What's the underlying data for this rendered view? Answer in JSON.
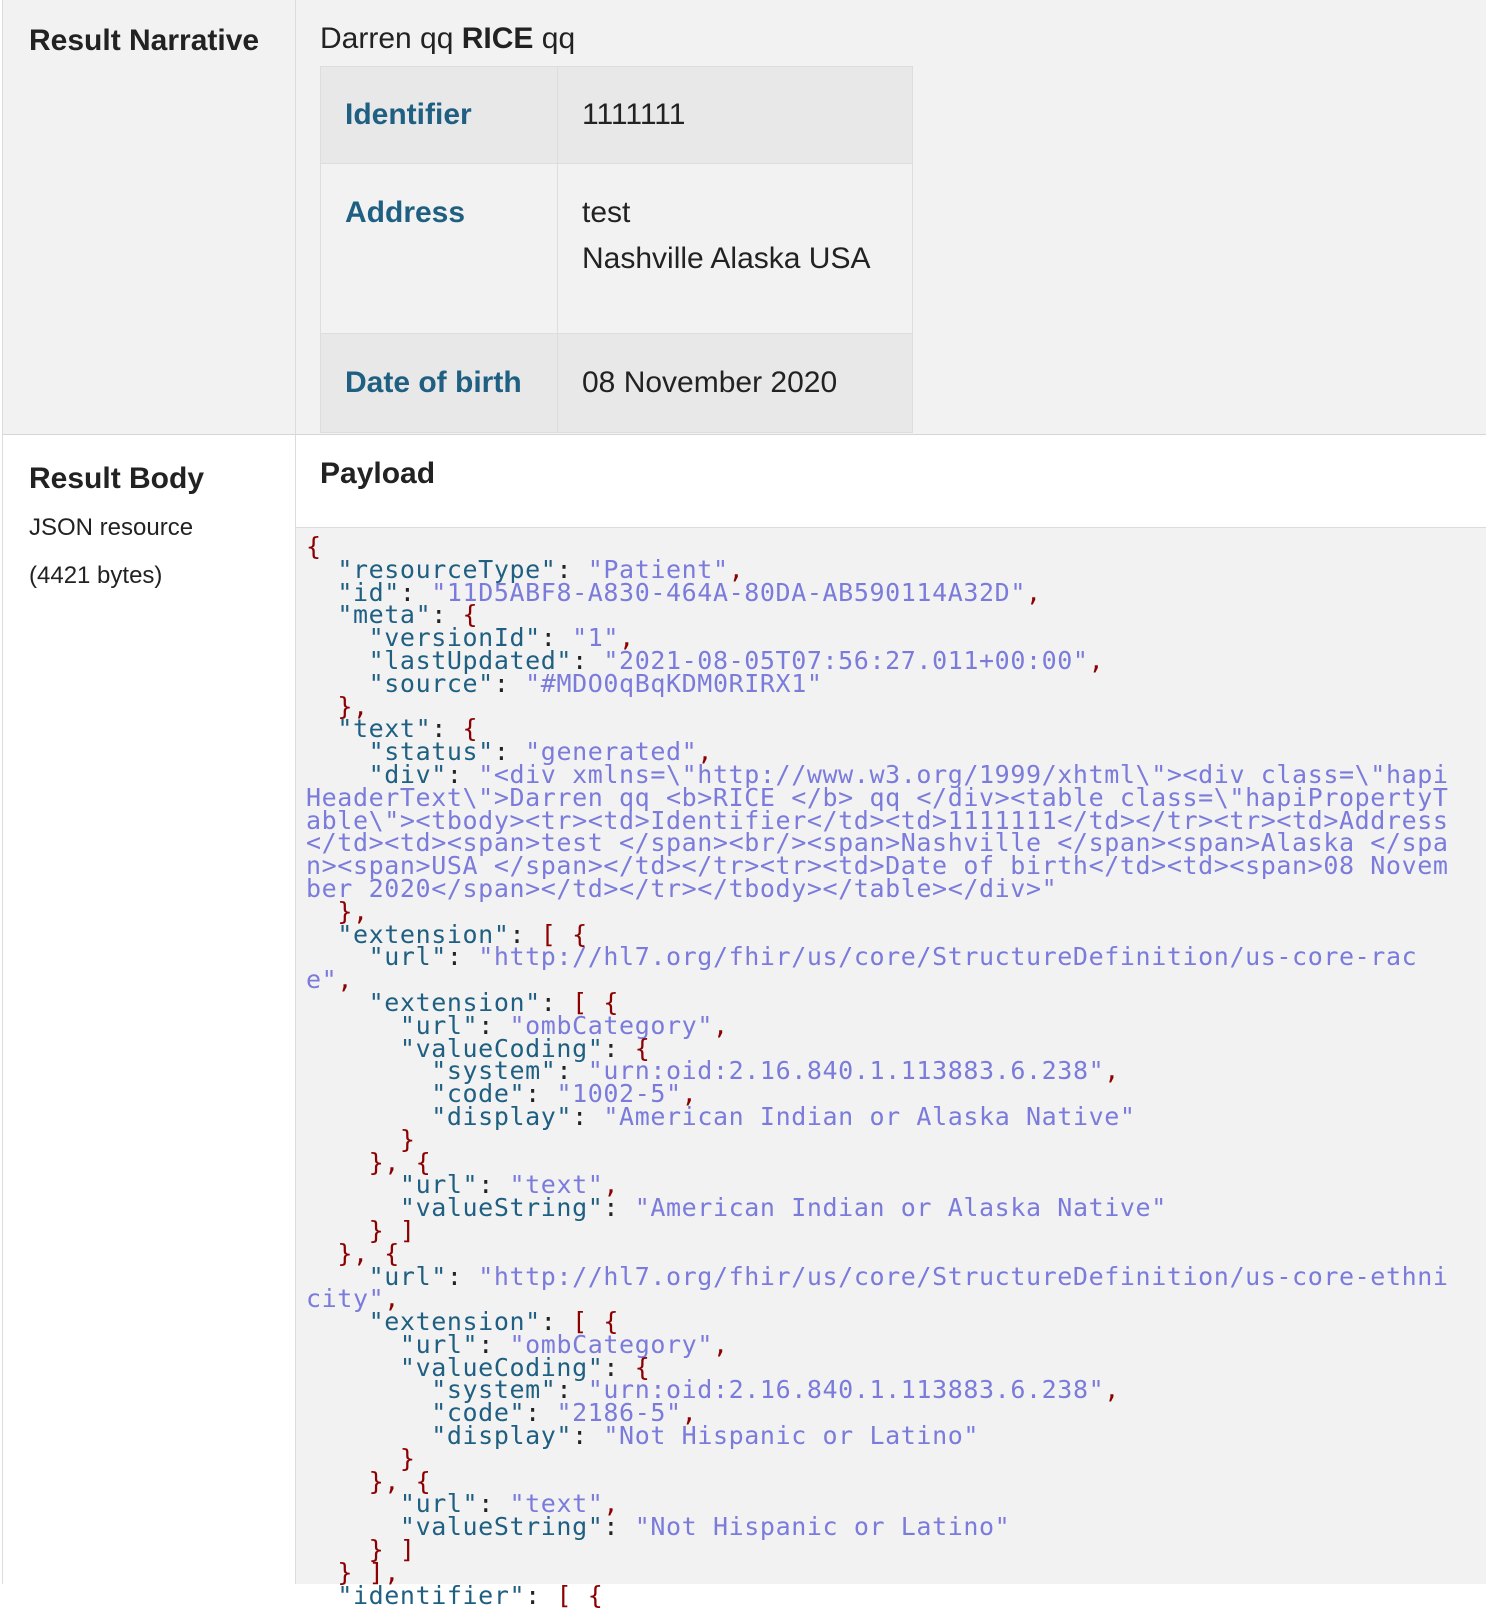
{
  "narrative": {
    "row_label": "Result Narrative",
    "header_name_given": "Darren qq ",
    "header_name_family": "RICE",
    "header_name_suffix": " qq",
    "rows": [
      {
        "label": "Identifier",
        "value_lines": [
          "1111111"
        ]
      },
      {
        "label": "Address",
        "value_lines": [
          "test",
          "Nashville Alaska USA"
        ]
      },
      {
        "label": "Date of birth",
        "value_lines": [
          "08 November 2020"
        ]
      }
    ]
  },
  "body": {
    "row_label": "Result Body",
    "format": "JSON resource",
    "size": "(4421 bytes)",
    "payload_title": "Payload",
    "json_text": "{\n  \"resourceType\": \"Patient\",\n  \"id\": \"11D5ABF8-A830-464A-80DA-AB590114A32D\",\n  \"meta\": {\n    \"versionId\": \"1\",\n    \"lastUpdated\": \"2021-08-05T07:56:27.011+00:00\",\n    \"source\": \"#MDO0qBqKDM0RIRX1\"\n  },\n  \"text\": {\n    \"status\": \"generated\",\n    \"div\": \"<div xmlns=\\\"http://www.w3.org/1999/xhtml\\\"><div class=\\\"hapiHeaderText\\\">Darren qq <b>RICE </b> qq </div><table class=\\\"hapiPropertyTable\\\"><tbody><tr><td>Identifier</td><td>1111111</td></tr><tr><td>Address</td><td><span>test </span><br/><span>Nashville </span><span>Alaska </span><span>USA </span></td></tr><tr><td>Date of birth</td><td><span>08 November 2020</span></td></tr></tbody></table></div>\"\n  },\n  \"extension\": [ {\n    \"url\": \"http://hl7.org/fhir/us/core/StructureDefinition/us-core-race\",\n    \"extension\": [ {\n      \"url\": \"ombCategory\",\n      \"valueCoding\": {\n        \"system\": \"urn:oid:2.16.840.1.113883.6.238\",\n        \"code\": \"1002-5\",\n        \"display\": \"American Indian or Alaska Native\"\n      }\n    }, {\n      \"url\": \"text\",\n      \"valueString\": \"American Indian or Alaska Native\"\n    } ]\n  }, {\n    \"url\": \"http://hl7.org/fhir/us/core/StructureDefinition/us-core-ethnicity\",\n    \"extension\": [ {\n      \"url\": \"ombCategory\",\n      \"valueCoding\": {\n        \"system\": \"urn:oid:2.16.840.1.113883.6.238\",\n        \"code\": \"2186-5\",\n        \"display\": \"Not Hispanic or Latino\"\n      }\n    }, {\n      \"url\": \"text\",\n      \"valueString\": \"Not Hispanic or Latino\"\n    } ]\n  } ],\n  \"identifier\": [ {"
  },
  "colors": {
    "punctuation": "#8b0000",
    "key": "#1f5f82",
    "string": "#7b7bdc",
    "panel_bg": "#f2f2f2",
    "table_alt_bg": "#e8e8e8"
  }
}
